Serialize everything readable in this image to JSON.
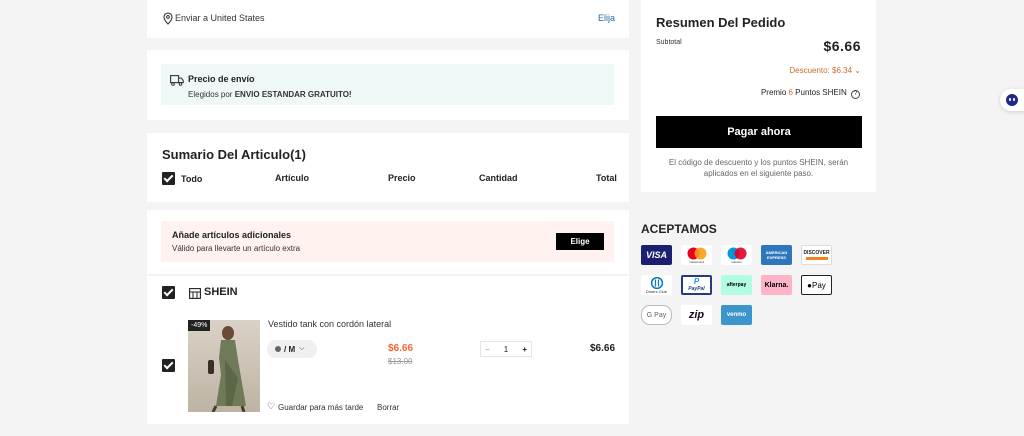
{
  "shipping": {
    "label": "Enviar a United States",
    "change": "Elija"
  },
  "notice": {
    "title": "Precio de envío",
    "prefix": "Elegidos por ",
    "method": "ENVIO ESTANDAR GRATUITO!"
  },
  "items_header": {
    "title": "Sumario Del Articulo(1)",
    "all": "Todo",
    "columns": [
      "Artículo",
      "Precio",
      "Cantidad",
      "Total"
    ]
  },
  "addon": {
    "title": "Añade artículos adicionales",
    "subtitle": "Válido para llevarte un artículo extra",
    "button": "Elige"
  },
  "store": {
    "name": "SHEIN"
  },
  "product": {
    "badge": "-49%",
    "name": "Vestido tank con cordón lateral",
    "variant": "/ M",
    "price": "$6.66",
    "original_price": "$13.00",
    "quantity": "1",
    "minus": "−",
    "plus": "+",
    "total": "$6.66",
    "save_later": "Guardar para más tarde",
    "delete": "Borrar"
  },
  "summary": {
    "title": "Resumen Del Pedido",
    "subtotal_label": "Subtotal",
    "subtotal_value": "$6.66",
    "discount": "Descuento: $6.34",
    "points_prefix": "Premio ",
    "points_value": "6",
    "points_suffix": " Puntos SHEIN",
    "pay_button": "Pagar ahora",
    "note_line1": "El código de descuento y los puntos SHEIN, serán",
    "note_line2": "aplicados en el siguiente paso."
  },
  "accept": {
    "title": "ACEPTAMOS",
    "methods": {
      "visa": "VISA",
      "mastercard": "mastercard",
      "maestro": "maestro",
      "amex": "AMERICAN EXPRESS",
      "discover": "DISCOVER",
      "diners": "Diners Club",
      "paypal": "PayPal",
      "afterpay": "afterpay",
      "klarna": "Klarna.",
      "applepay": " Pay",
      "googlepay": "G Pay",
      "zip": "zip",
      "venmo": "venmo"
    }
  },
  "colors": {
    "accent": "#d06b2c",
    "price_red": "#fa6338",
    "link_blue": "#2d68a8",
    "notice_bg": "#eef9f7",
    "addon_bg": "#fff2ef"
  }
}
